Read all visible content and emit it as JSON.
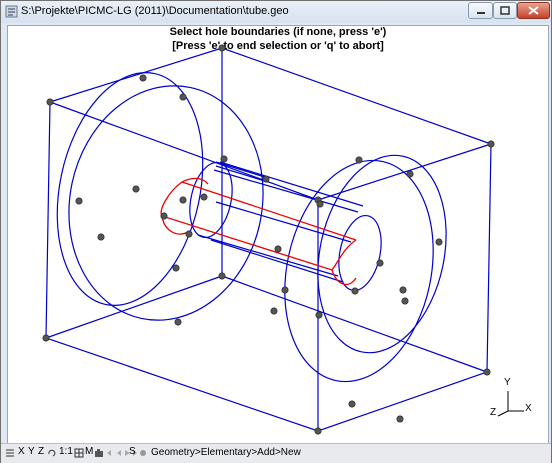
{
  "window": {
    "title": "S:\\Projekte\\PICMC-LG (2011)\\Documentation\\tube.geo"
  },
  "viewport": {
    "message_line1": "Select hole boundaries (if none, press 'e')",
    "message_line2": "[Press 'e' to end selection or 'q' to abort]",
    "axis_y": "Y",
    "axis_x": "X",
    "axis_z": "Z"
  },
  "statusbar": {
    "btn_x": "X",
    "btn_y": "Y",
    "btn_z": "Z",
    "btn_scale": "1:1",
    "btn_m": "M",
    "btn_s": "S",
    "breadcrumb": "Geometry>Elementary>Add>New"
  },
  "colors": {
    "lines": "#0000cc",
    "highlight": "#ee0000",
    "points": "#555555"
  }
}
